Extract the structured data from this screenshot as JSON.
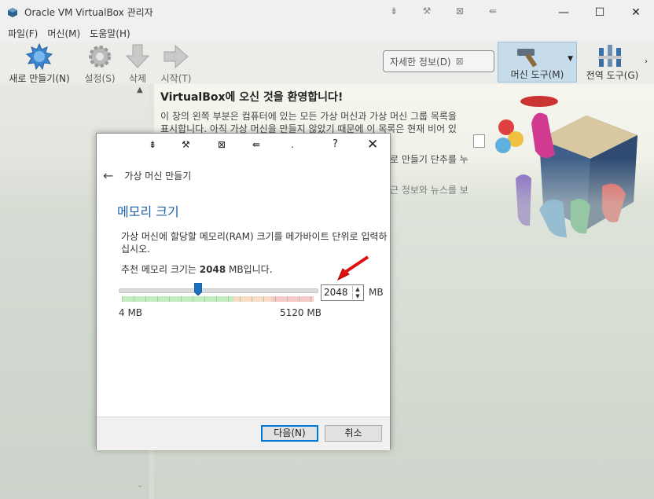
{
  "window": {
    "title": "Oracle VM VirtualBox 관리자",
    "title_tools": [
      "⇟",
      "⚒",
      "⊠",
      "⇚"
    ],
    "controls": {
      "minimize": "—",
      "maximize": "☐",
      "close": "✕"
    }
  },
  "menu": [
    "파일(F)",
    "머신(M)",
    "도움말(H)"
  ],
  "toolbar": {
    "new": "새로 만들기(N)",
    "settings": "설정(S)",
    "delete": "삭제",
    "start": "시작(T)",
    "details": "자세한 정보(D)",
    "machine_tools": "머신 도구(M)",
    "global_tools": "전역 도구(G)"
  },
  "welcome": {
    "title": "VirtualBox에 오신 것을 환영합니다!",
    "line1": "이 창의 왼쪽 부분은 컴퓨터에 있는 모든 가상 머신과 가상 머신 그룹 목록을",
    "line2": "표시합니다. 아직 가상 머신을 만들지 않았기 때문에 이 목록은 현재 비어 있",
    "line3": "로 만들기 단추를 누",
    "line4": "근 정보와 뉴스를 보"
  },
  "dialog": {
    "tools": [
      "⇟",
      "⚒",
      "⊠",
      "⇚",
      "."
    ],
    "help": "?",
    "close": "✕",
    "header": "가상 머신 만들기",
    "section_title": "메모리 크기",
    "description": "가상 머신에 할당할 메모리(RAM) 크기를 메가바이트 단위로 입력하십시오.",
    "recommend_prefix": "추천 메모리 크기는 ",
    "recommend_value": "2048",
    "recommend_suffix": " MB입니다.",
    "slider_min": "4 MB",
    "slider_max": "5120 MB",
    "memory_value": "2048",
    "memory_fraction": 0.4,
    "unit": "MB",
    "next_button": "다음(N)",
    "cancel_button": "취소"
  },
  "colors": {
    "accent_blue": "#1f5fa8",
    "selected_tool_bg": "#c6dcea",
    "arrow_red": "#e01010"
  }
}
